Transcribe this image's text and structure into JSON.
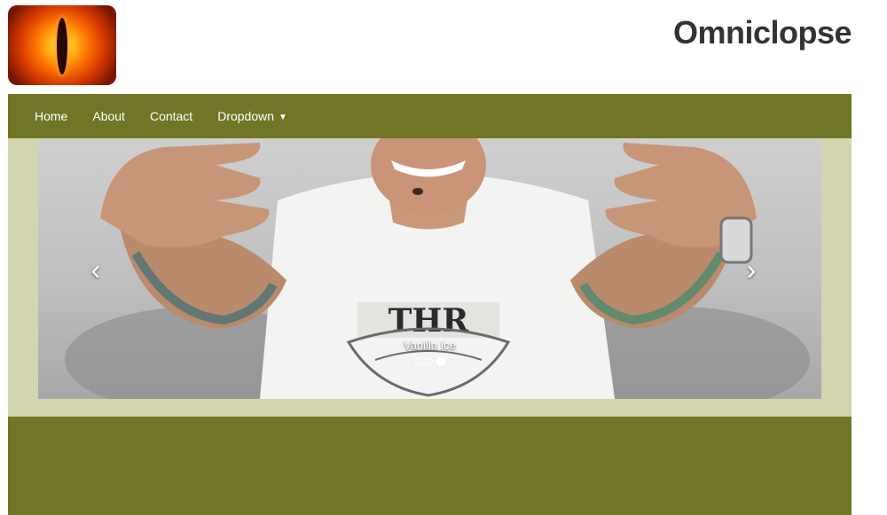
{
  "site": {
    "title": "Omniclopse"
  },
  "nav": {
    "items": [
      {
        "label": "Home"
      },
      {
        "label": "About"
      },
      {
        "label": "Contact"
      },
      {
        "label": "Dropdown"
      }
    ]
  },
  "carousel": {
    "caption": "Vanilla Ice",
    "slide_count": 3,
    "active_index": 2,
    "prev_icon": "chevron-left-icon",
    "next_icon": "chevron-right-icon"
  },
  "colors": {
    "nav_bg": "#707625",
    "well_bg": "#d3d5ae",
    "title_text": "#333333"
  }
}
